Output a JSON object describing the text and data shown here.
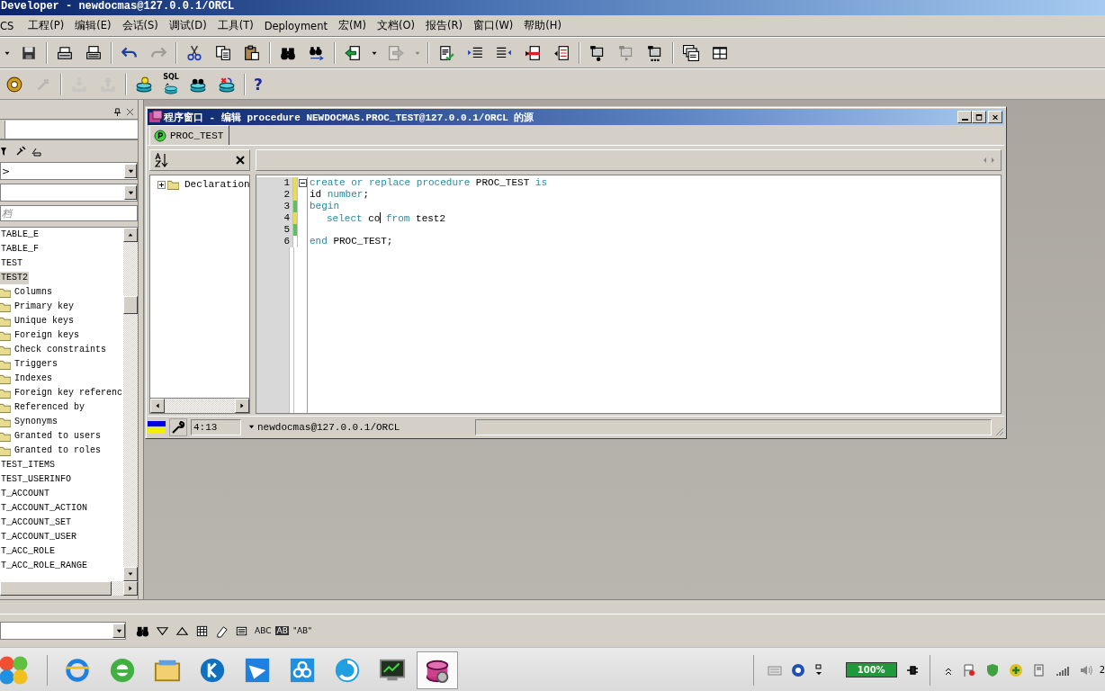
{
  "window": {
    "title": "Developer - newdocmas@127.0.0.1/ORCL"
  },
  "menu": [
    "CS",
    "工程(P)",
    "编辑(E)",
    "会话(S)",
    "调试(D)",
    "工具(T)",
    "Deployment",
    "宏(M)",
    "文档(O)",
    "报告(R)",
    "窗口(W)",
    "帮助(H)"
  ],
  "toolbar_main": [
    {
      "kind": "caret",
      "disabled": false
    },
    {
      "kind": "save",
      "disabled": false
    },
    {
      "kind": "separator"
    },
    {
      "kind": "print",
      "disabled": false
    },
    {
      "kind": "printpreview",
      "disabled": false
    },
    {
      "kind": "separator"
    },
    {
      "kind": "undo",
      "disabled": false
    },
    {
      "kind": "redo",
      "disabled": true
    },
    {
      "kind": "separator"
    },
    {
      "kind": "cut",
      "disabled": false
    },
    {
      "kind": "copy",
      "disabled": false
    },
    {
      "kind": "paste",
      "disabled": false
    },
    {
      "kind": "separator"
    },
    {
      "kind": "find",
      "disabled": false
    },
    {
      "kind": "findnext",
      "disabled": false
    },
    {
      "kind": "separator"
    },
    {
      "kind": "load",
      "disabled": false
    },
    {
      "kind": "caret",
      "disabled": false
    },
    {
      "kind": "export",
      "disabled": true
    },
    {
      "kind": "caret",
      "disabled": true
    },
    {
      "kind": "separator"
    },
    {
      "kind": "doccheck",
      "disabled": false
    },
    {
      "kind": "indent",
      "disabled": false
    },
    {
      "kind": "unindent",
      "disabled": false
    },
    {
      "kind": "docred",
      "disabled": false
    },
    {
      "kind": "docleft",
      "disabled": false
    },
    {
      "kind": "separator"
    },
    {
      "kind": "macrorec",
      "disabled": false
    },
    {
      "kind": "macroplay",
      "disabled": true
    },
    {
      "kind": "macromore",
      "disabled": false
    },
    {
      "kind": "separator"
    },
    {
      "kind": "cascade",
      "disabled": false
    },
    {
      "kind": "tile",
      "disabled": false
    }
  ],
  "toolbar_secondary": [
    {
      "kind": "gear",
      "disabled": false
    },
    {
      "kind": "plug",
      "disabled": true
    },
    {
      "kind": "separator"
    },
    {
      "kind": "import",
      "disabled": true
    },
    {
      "kind": "exportdb",
      "disabled": true
    },
    {
      "kind": "separator"
    },
    {
      "kind": "dbbulb",
      "disabled": false
    },
    {
      "kind": "dbsql",
      "disabled": false,
      "label": "SQL"
    },
    {
      "kind": "dbfind",
      "disabled": false
    },
    {
      "kind": "dbx",
      "disabled": false
    },
    {
      "kind": "separator"
    },
    {
      "kind": "help",
      "disabled": false,
      "label": "?"
    }
  ],
  "object_browser": {
    "dropdowns": [
      {
        "value": ">"
      }
    ],
    "filter": {
      "placeholder": "档"
    },
    "items": [
      {
        "label": "TABLE_E",
        "selected": false
      },
      {
        "label": "TABLE_F",
        "selected": false
      },
      {
        "label": "TEST",
        "selected": false
      },
      {
        "label": "TEST2",
        "selected": true,
        "children": [
          {
            "label": "Columns",
            "selected": false
          },
          {
            "label": "Primary key",
            "selected": false
          },
          {
            "label": "Unique keys",
            "selected": false
          },
          {
            "label": "Foreign keys",
            "selected": false
          },
          {
            "label": "Check constraints",
            "selected": false
          },
          {
            "label": "Triggers",
            "selected": false
          },
          {
            "label": "Indexes",
            "selected": false
          },
          {
            "label": "Foreign key referenc",
            "selected": false
          },
          {
            "label": "Referenced by",
            "selected": false
          },
          {
            "label": "Synonyms",
            "selected": false
          },
          {
            "label": "Granted to users",
            "selected": false
          },
          {
            "label": "Granted to roles",
            "selected": false
          }
        ]
      },
      {
        "label": "TEST_ITEMS",
        "selected": false
      },
      {
        "label": "TEST_USERINFO",
        "selected": false
      },
      {
        "label": "T_ACCOUNT",
        "selected": false
      },
      {
        "label": "T_ACCOUNT_ACTION",
        "selected": false
      },
      {
        "label": "T_ACCOUNT_SET",
        "selected": false
      },
      {
        "label": "T_ACCOUNT_USER",
        "selected": false
      },
      {
        "label": "T_ACC_ROLE",
        "selected": false
      },
      {
        "label": "T_ACC_ROLE_RANGE",
        "selected": false
      }
    ]
  },
  "editor_window": {
    "title": "程序窗口 - 编辑 procedure NEWDOCMAS.PROC_TEST@127.0.0.1/ORCL 的源",
    "tabs": [
      {
        "label": "PROC_TEST",
        "selected": true
      }
    ],
    "outline": [
      {
        "label": "Declaration",
        "expanded": false
      }
    ],
    "lines": [
      {
        "number": "1",
        "color": "#e8dc50",
        "fold": true,
        "tokens": [
          {
            "text": "create or replace procedure",
            "kind": "keyword"
          },
          {
            "text": " PROC_TEST ",
            "kind": "plain"
          },
          {
            "text": "is",
            "kind": "keyword"
          }
        ]
      },
      {
        "number": "2",
        "color": "#e8dc50",
        "tokens": [
          {
            "text": "id ",
            "kind": "plain"
          },
          {
            "text": "number",
            "kind": "keyword"
          },
          {
            "text": ";",
            "kind": "plain"
          }
        ]
      },
      {
        "number": "3",
        "color": "#60c060",
        "tokens": [
          {
            "text": "begin",
            "kind": "keyword"
          }
        ]
      },
      {
        "number": "4",
        "color": "#e8dc50",
        "tokens": [
          {
            "kind": "indent"
          },
          {
            "text": "select",
            "kind": "keyword"
          },
          {
            "text": " co",
            "kind": "plain"
          },
          {
            "kind": "cursor"
          },
          {
            "text": " from",
            "kind": "keyword"
          },
          {
            "text": " test2",
            "kind": "plain"
          }
        ]
      },
      {
        "number": "5",
        "color": "#60c060"
      },
      {
        "number": "6",
        "tokens": [
          {
            "text": "end",
            "kind": "keyword"
          },
          {
            "text": " PROC_TEST;",
            "kind": "plain"
          }
        ]
      }
    ],
    "status": {
      "position": "4:13",
      "connection": "newdocmas@127.0.0.1/ORCL"
    }
  },
  "find_bar": {
    "buttons": [
      {
        "kind": "find"
      },
      {
        "kind": "down"
      },
      {
        "kind": "up"
      },
      {
        "kind": "grid"
      },
      {
        "kind": "eraser"
      },
      {
        "kind": "list"
      },
      {
        "kind": "text",
        "label": "ABC"
      },
      {
        "kind": "inverted",
        "label": "AB"
      },
      {
        "kind": "text",
        "label": "\"AB\""
      }
    ]
  },
  "taskbar": {
    "tasks": [
      {
        "kind": "ie",
        "selected": false
      },
      {
        "kind": "iegreen",
        "selected": false
      },
      {
        "kind": "explorer",
        "selected": false
      },
      {
        "kind": "kapp",
        "selected": false
      },
      {
        "kind": "bird",
        "selected": false
      },
      {
        "kind": "cloud",
        "selected": false
      },
      {
        "kind": "swirl",
        "selected": false
      },
      {
        "kind": "monitor",
        "selected": false
      },
      {
        "kind": "database",
        "selected": true
      }
    ],
    "battery": "100%",
    "clock": "2"
  }
}
